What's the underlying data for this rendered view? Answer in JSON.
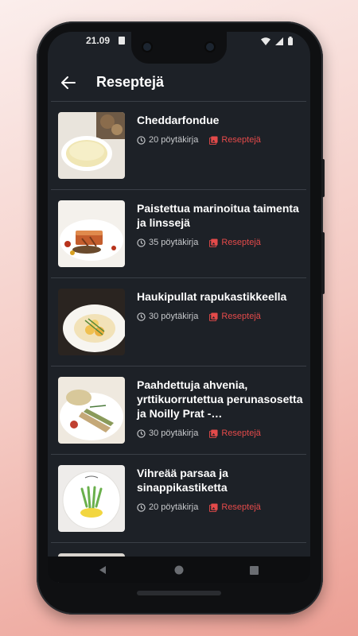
{
  "status_bar": {
    "time": "21.09"
  },
  "app_bar": {
    "title": "Reseptejä"
  },
  "recipes": [
    {
      "title": "Cheddarfondue",
      "time": "20 pöytäkirja",
      "category": "Reseptejä"
    },
    {
      "title": "Paistettua marinoitua taimenta ja linssejä",
      "time": "35 pöytäkirja",
      "category": "Reseptejä"
    },
    {
      "title": "Haukipullat rapukastikkeella",
      "time": "30 pöytäkirja",
      "category": "Reseptejä"
    },
    {
      "title": "Paahdettuja ahvenia, yrttikuorrutettua perunasosetta ja Noilly Prat -…",
      "time": "30 pöytäkirja",
      "category": "Reseptejä"
    },
    {
      "title": "Vihreää parsaa ja sinappikastiketta",
      "time": "20 pöytäkirja",
      "category": "Reseptejä"
    }
  ],
  "colors": {
    "background": "#1d2127",
    "accent": "#e34a4a",
    "text": "#ffffff",
    "muted": "#c7c9cc"
  }
}
